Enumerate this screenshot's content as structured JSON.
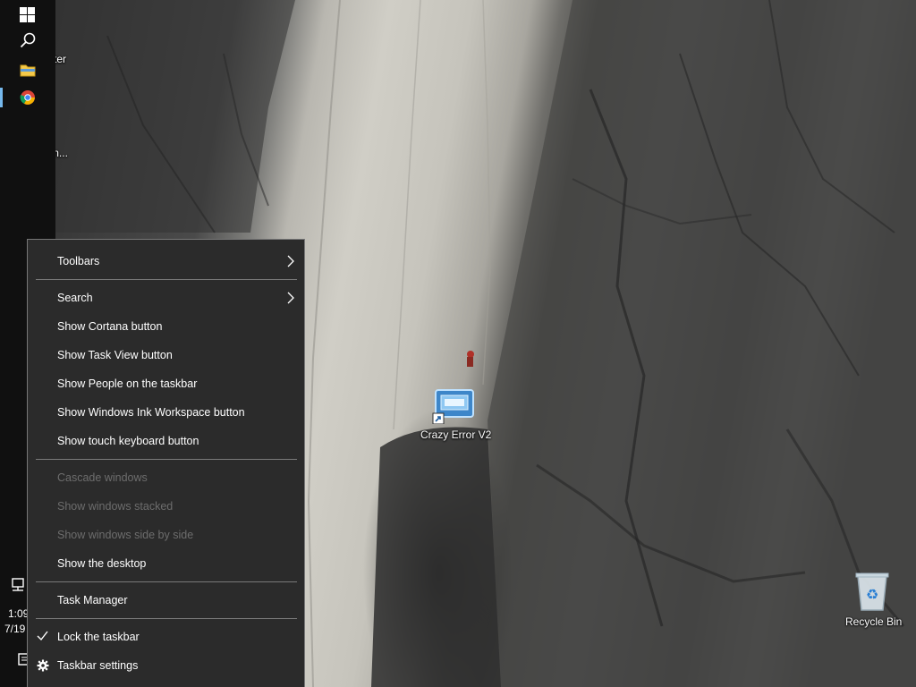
{
  "desktop": {
    "icons": [
      {
        "id": "my-computer",
        "label": "My Computer"
      },
      {
        "id": "datawagon",
        "label": "DataWagon..."
      },
      {
        "id": "crazy-error",
        "label": "Crazy Error V2"
      },
      {
        "id": "recycle-bin",
        "label": "Recycle Bin"
      }
    ]
  },
  "taskbar": {
    "buttons": [
      {
        "id": "start",
        "icon": "windows-logo-icon"
      },
      {
        "id": "search",
        "icon": "search-icon"
      },
      {
        "id": "file-explorer",
        "icon": "folder-icon"
      },
      {
        "id": "chrome",
        "icon": "chrome-icon"
      }
    ],
    "tray": {
      "time": "1:09",
      "date": "7/19",
      "network_icon": "network-icon",
      "notifications_icon": "notification-icon"
    }
  },
  "context_menu": {
    "items": [
      {
        "label": "Toolbars",
        "submenu": true
      },
      {
        "label": "Search",
        "submenu": true
      },
      {
        "label": "Show Cortana button"
      },
      {
        "label": "Show Task View button"
      },
      {
        "label": "Show People on the taskbar"
      },
      {
        "label": "Show Windows Ink Workspace button"
      },
      {
        "label": "Show touch keyboard button"
      },
      {
        "label": "Cascade windows",
        "disabled": true
      },
      {
        "label": "Show windows stacked",
        "disabled": true
      },
      {
        "label": "Show windows side by side",
        "disabled": true
      },
      {
        "label": "Show the desktop"
      },
      {
        "label": "Task Manager"
      },
      {
        "label": "Lock the taskbar",
        "checked": true
      },
      {
        "label": "Taskbar settings",
        "icon": "gear-icon"
      }
    ]
  },
  "colors": {
    "menu_bg": "#2b2b2b",
    "menu_text": "#ffffff",
    "menu_disabled": "#6d6d6d",
    "taskbar_bg": "#101010",
    "accent": "#76b9ed"
  }
}
